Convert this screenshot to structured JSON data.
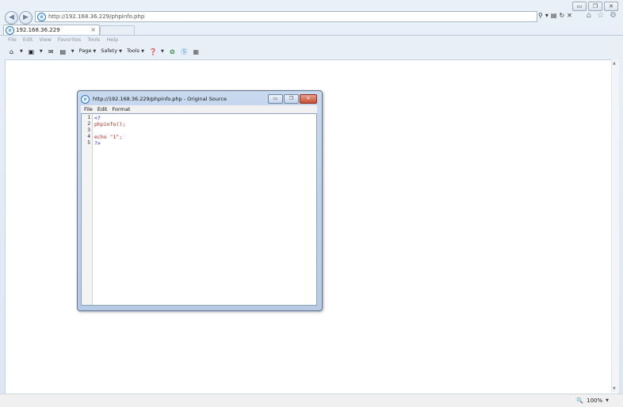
{
  "browser": {
    "url_host": "http://192.168.36.229",
    "url_path": "/phpinfo.php",
    "tab_title": "192.168.36.229",
    "tab_close": "×",
    "menu": [
      "File",
      "Edit",
      "View",
      "Favorites",
      "Tools",
      "Help"
    ],
    "commands": {
      "page": "Page",
      "safety": "Safety",
      "tools": "Tools"
    },
    "zoom": "100%"
  },
  "popup": {
    "title": "http://192.168.36.229/phpinfo.php - Original Source",
    "menu": [
      "File",
      "Edit",
      "Format"
    ],
    "lines": [
      {
        "num": "1",
        "text": "<?"
      },
      {
        "num": "2",
        "text": "phpinfo();"
      },
      {
        "num": "3",
        "text": ""
      },
      {
        "num": "4",
        "text": "echo \"1\";"
      },
      {
        "num": "5",
        "text": "?>"
      }
    ]
  },
  "colors": {
    "tag": "#1a1ad6",
    "keyword": "#c21b1b"
  }
}
